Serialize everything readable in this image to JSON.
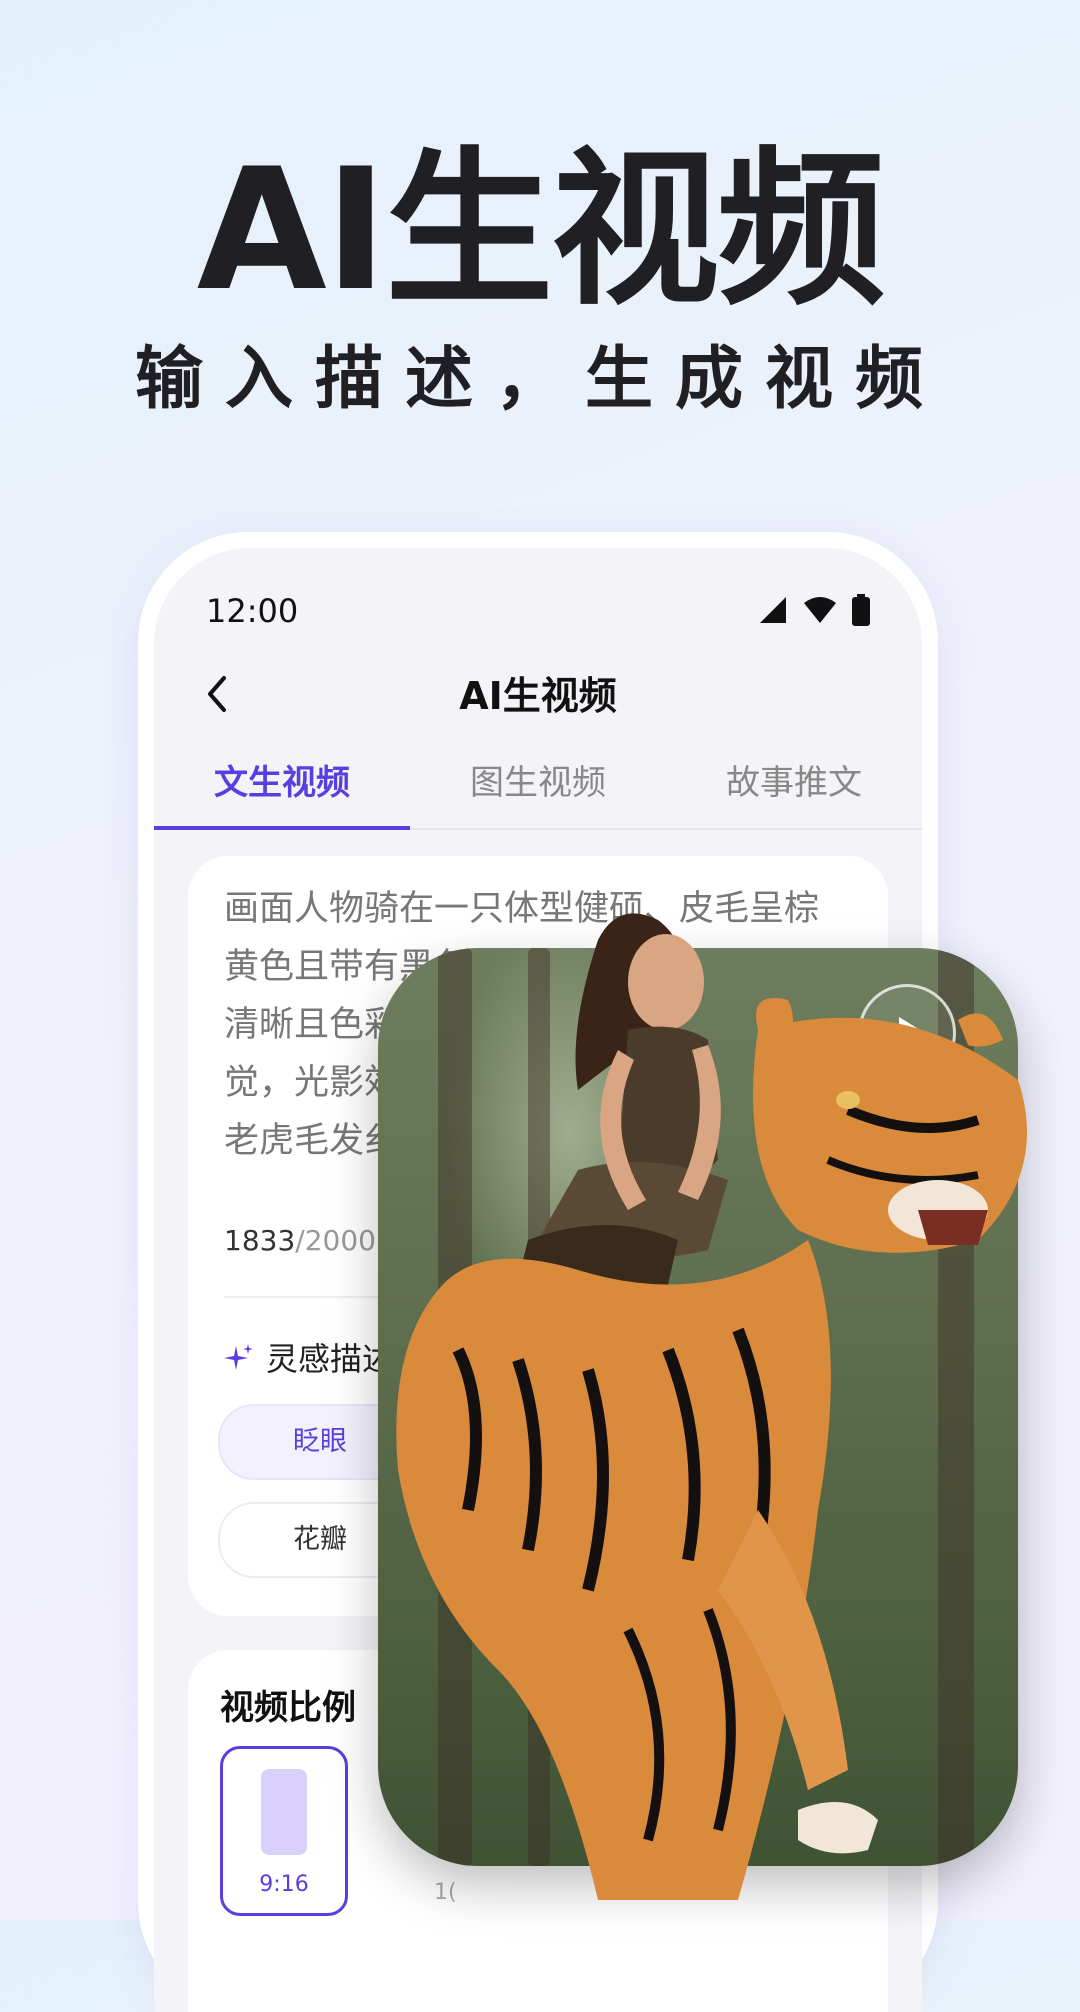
{
  "promo": {
    "title": "AI生视频",
    "subtitle": "输入描述，生成视频"
  },
  "status_bar": {
    "time": "12:00",
    "icons": [
      "signal-icon",
      "wifi-icon",
      "battery-icon"
    ]
  },
  "nav": {
    "title": "AI生视频",
    "back_icon": "back-chevron-icon"
  },
  "tabs": [
    {
      "label": "文生视频",
      "active": true
    },
    {
      "label": "图生视频",
      "active": false
    },
    {
      "label": "故事推文",
      "active": false
    }
  ],
  "prompt": {
    "lines": [
      "画面人物骑在一只体型健硕、皮毛呈棕",
      "黄色且带有黑色条纹的东北虎",
      "清晰且色彩",
      "觉，光影效",
      "老虎毛发纟"
    ],
    "count": "1833",
    "total": "/2000"
  },
  "inspiration": {
    "label": "灵感描述",
    "chips": [
      "眨眼",
      "花瓣"
    ]
  },
  "ratio": {
    "title": "视频比例",
    "options": [
      "9:16",
      "1("
    ]
  },
  "colors": {
    "accent": "#5a3ee0",
    "background": "#eef1fb"
  }
}
